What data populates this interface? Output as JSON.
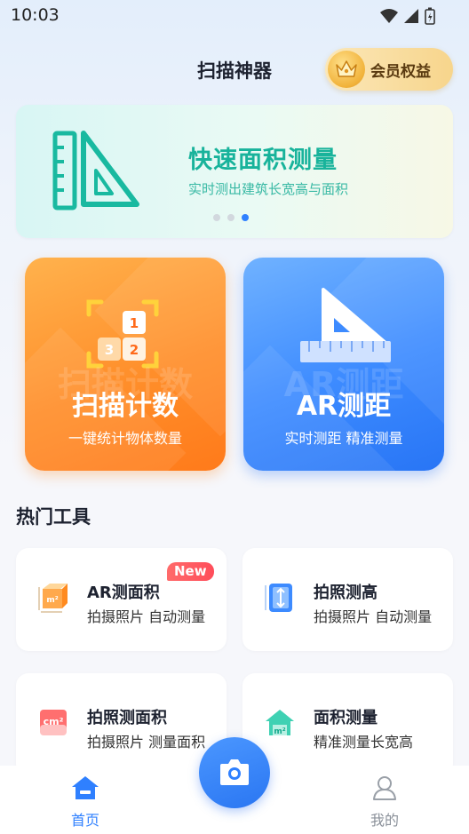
{
  "status_bar": {
    "time": "10:03"
  },
  "header": {
    "title": "扫描神器",
    "vip_label": "会员权益"
  },
  "banner": {
    "title": "快速面积测量",
    "subtitle": "实时测出建筑长宽高与面积",
    "pages": 3,
    "active_page": 3
  },
  "feature_cards": [
    {
      "title": "扫描计数",
      "watermark": "扫描计数",
      "subtitle": "一键统计物体数量",
      "numbers": [
        "1",
        "3",
        "2"
      ]
    },
    {
      "title": "AR测距",
      "watermark": "AR测距",
      "subtitle": "实时测距 精准测量"
    }
  ],
  "hot_tools": {
    "title": "热门工具",
    "items": [
      {
        "name": "AR测面积",
        "desc": "拍摄照片 自动测量",
        "badge": "New"
      },
      {
        "name": "拍照测高",
        "desc": "拍摄照片 自动测量"
      },
      {
        "name": "拍照测面积",
        "desc": "拍摄照片 测量面积"
      },
      {
        "name": "面积测量",
        "desc": "精准测量长宽高"
      }
    ]
  },
  "bottom_nav": {
    "items": [
      {
        "label": "首页",
        "active": true
      },
      {
        "label": "我的",
        "active": false
      }
    ]
  },
  "colors": {
    "primary": "#2f80ff",
    "teal": "#18b39b",
    "orange": "#ff8f2b"
  }
}
